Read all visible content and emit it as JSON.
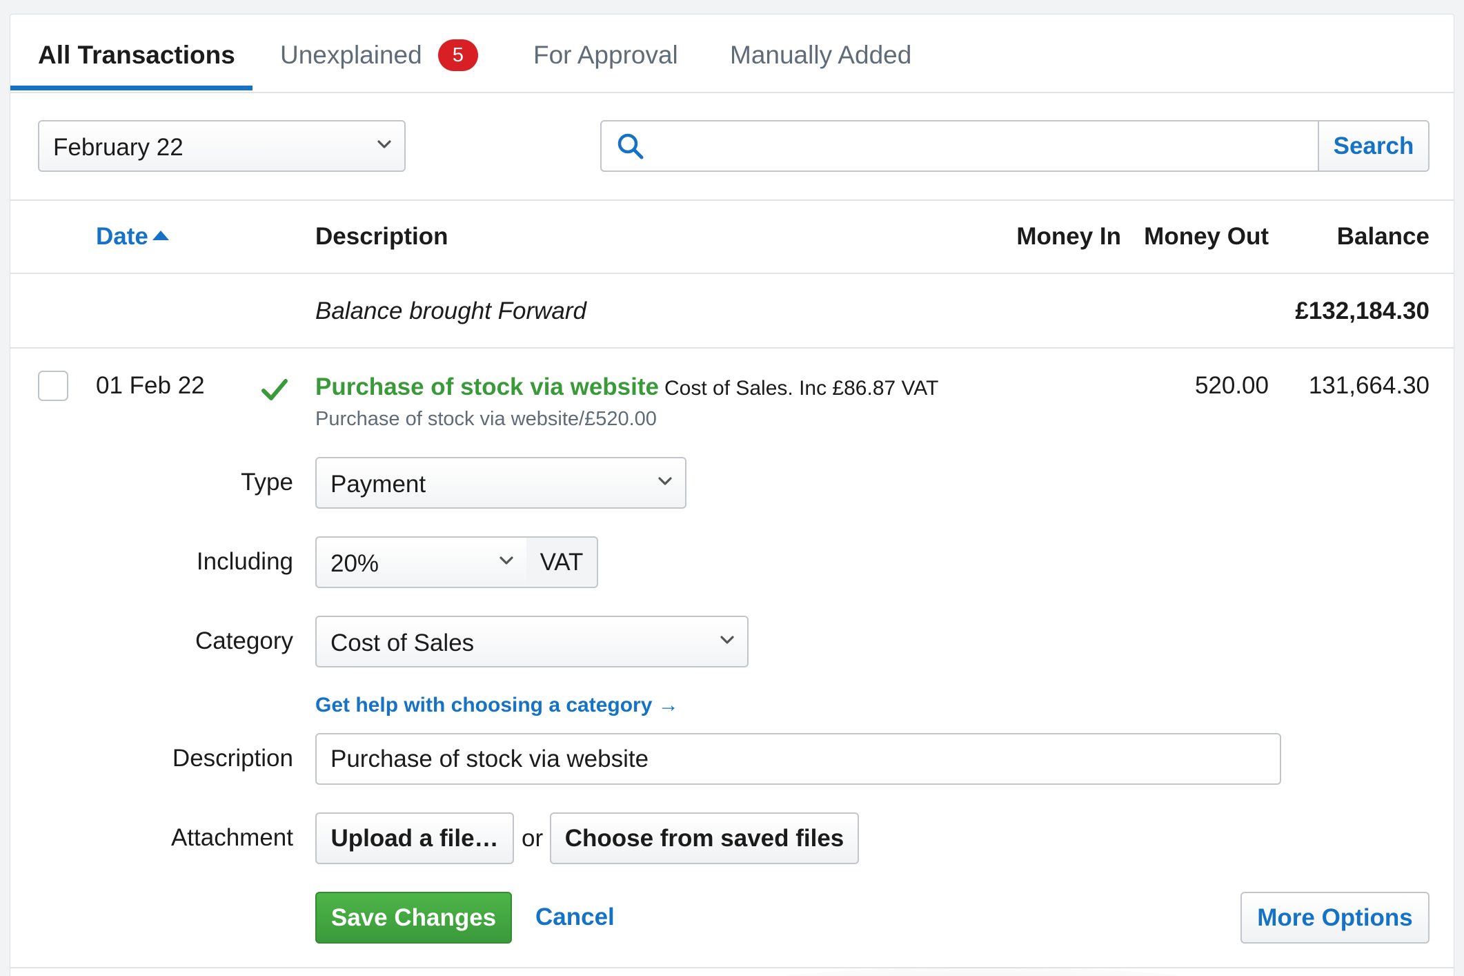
{
  "tabs": [
    {
      "label": "All Transactions",
      "active": true
    },
    {
      "label": "Unexplained",
      "badge": "5"
    },
    {
      "label": "For Approval"
    },
    {
      "label": "Manually Added"
    }
  ],
  "filters": {
    "period_value": "February 22",
    "search_placeholder": "",
    "search_button": "Search"
  },
  "table": {
    "headers": {
      "date": "Date",
      "description": "Description",
      "money_in": "Money In",
      "money_out": "Money Out",
      "balance": "Balance"
    },
    "balance_forward": {
      "label": "Balance brought Forward",
      "amount": "£132,184.30"
    },
    "row": {
      "date": "01 Feb 22",
      "title": "Purchase of stock via website",
      "meta": "Cost of Sales. Inc £86.87 VAT",
      "subtitle": "Purchase of stock via website/£520.00",
      "money_in": "",
      "money_out": "520.00",
      "balance": "131,664.30",
      "explained": true
    }
  },
  "form": {
    "type_label": "Type",
    "type_value": "Payment",
    "including_label": "Including",
    "vat_rate": "20%",
    "vat_suffix": "VAT",
    "category_label": "Category",
    "category_value": "Cost of Sales",
    "help_link": "Get help with choosing a category →",
    "description_label": "Description",
    "description_value": "Purchase of stock via website",
    "attachment_label": "Attachment",
    "upload_button": "Upload a file…",
    "or_text": "or",
    "choose_button": "Choose from saved files",
    "save_button": "Save Changes",
    "cancel_link": "Cancel",
    "more_options_button": "More Options"
  },
  "colors": {
    "accent": "#1672c4",
    "success": "#3a9a3a",
    "badge": "#d91f26"
  }
}
